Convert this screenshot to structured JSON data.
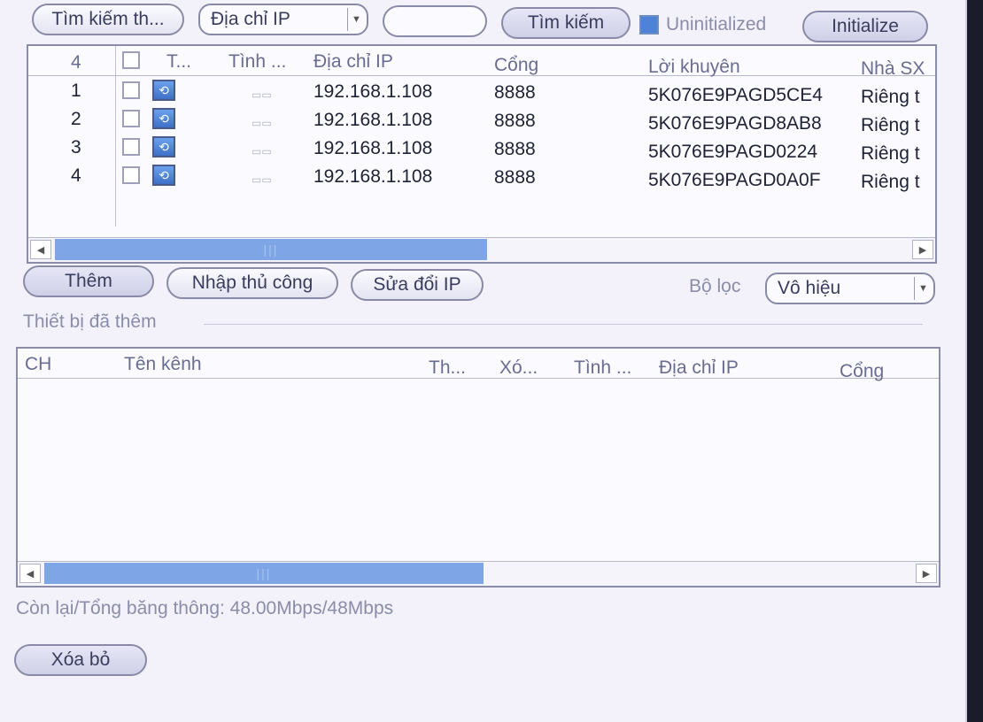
{
  "toolbar": {
    "search_type_label": "Tìm kiếm th...",
    "address_type_value": "Địa chỉ IP",
    "search_field_value": "",
    "search_button": "Tìm kiếm",
    "uninitialized_label": "Uninitialized",
    "initialize_button": "Initialize"
  },
  "device_table": {
    "count": "4",
    "columns": [
      "T...",
      "Tình ...",
      "Địa chỉ IP",
      "Cổng",
      "Lời khuyên",
      "Nhà SX"
    ],
    "rows": [
      {
        "index": "1",
        "ip": "192.168.1.108",
        "port": "8888",
        "serial": "5K076E9PAGD5CE4",
        "vendor": "Riêng t"
      },
      {
        "index": "2",
        "ip": "192.168.1.108",
        "port": "8888",
        "serial": "5K076E9PAGD8AB8",
        "vendor": "Riêng t"
      },
      {
        "index": "3",
        "ip": "192.168.1.108",
        "port": "8888",
        "serial": "5K076E9PAGD0224",
        "vendor": "Riêng t"
      },
      {
        "index": "4",
        "ip": "192.168.1.108",
        "port": "8888",
        "serial": "5K076E9PAGD0A0F",
        "vendor": "Riêng t"
      }
    ]
  },
  "actions": {
    "add": "Thêm",
    "manual_add": "Nhập thủ công",
    "modify_ip": "Sửa đổi IP",
    "filter_label": "Bộ lọc",
    "filter_value": "Vô hiệu"
  },
  "added_devices": {
    "section_title": "Thiết bị đã thêm",
    "columns": [
      "CH",
      "Tên kênh",
      "Th...",
      "Xó...",
      "Tình ...",
      "Địa chỉ IP",
      "Cổng"
    ]
  },
  "footer": {
    "bandwidth": "Còn lại/Tổng băng thông: 48.00Mbps/48Mbps",
    "delete": "Xóa bỏ"
  }
}
